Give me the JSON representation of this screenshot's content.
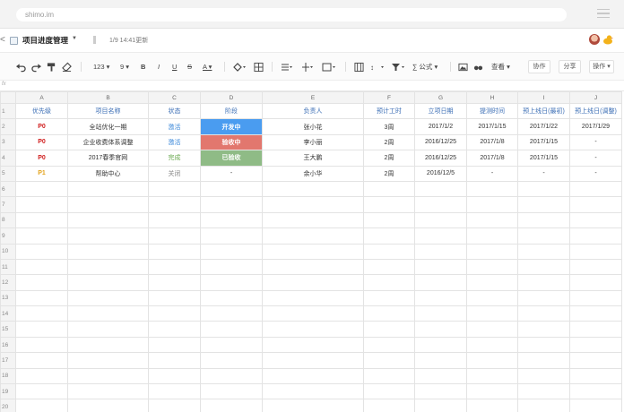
{
  "browser": {
    "url": "shimo.im"
  },
  "doc": {
    "back": "<",
    "title": "项目进度管理",
    "caret": "▼",
    "time": "1/9 14:41更新"
  },
  "toolbar": {
    "font_size_label": "123 ▾",
    "size": "9 ▾",
    "bold": "B",
    "italic": "I",
    "underline": "U",
    "strike": "S",
    "color": "A ▾",
    "formula": "∑ 公式 ▾",
    "view": "查看 ▾",
    "collab": "协作",
    "share": "分享",
    "ops": "操作 ▾"
  },
  "formula_bar": {
    "fx": "fx"
  },
  "columns": [
    "A",
    "B",
    "C",
    "D",
    "E",
    "F",
    "G",
    "H",
    "I",
    "J"
  ],
  "header": [
    "优先级",
    "项目名称",
    "状态",
    "阶段",
    "负责人",
    "预计工时",
    "立项日期",
    "提测时间",
    "预上线日(最初)",
    "预上线日(调整)"
  ],
  "rows": [
    [
      "P0",
      "全站优化一期",
      "激活",
      "开发中",
      "张小花",
      "3周",
      "2017/1/2",
      "2017/1/15",
      "2017/1/22",
      "2017/1/29"
    ],
    [
      "P0",
      "企业收费体系调整",
      "激活",
      "验收中",
      "李小丽",
      "2周",
      "2016/12/25",
      "2017/1/8",
      "2017/1/15",
      "-"
    ],
    [
      "P0",
      "2017春季官网",
      "完成",
      "已验收",
      "王大鹏",
      "2周",
      "2016/12/25",
      "2017/1/8",
      "2017/1/15",
      "-"
    ],
    [
      "P1",
      "帮助中心",
      "关闭",
      "-",
      "余小华",
      "2周",
      "2016/12/5",
      "-",
      "-",
      "-"
    ]
  ],
  "row_numbers": [
    "1",
    "2",
    "3",
    "4",
    "5",
    "6",
    "7",
    "8",
    "9",
    "10",
    "11",
    "12",
    "13",
    "14",
    "15",
    "16",
    "17",
    "18",
    "19",
    "20"
  ],
  "colors": {
    "dev": "#4a9cf0",
    "check": "#e2776e",
    "done": "#8fbb86",
    "p0": "#d01c1c",
    "p1": "#e3a21a"
  }
}
